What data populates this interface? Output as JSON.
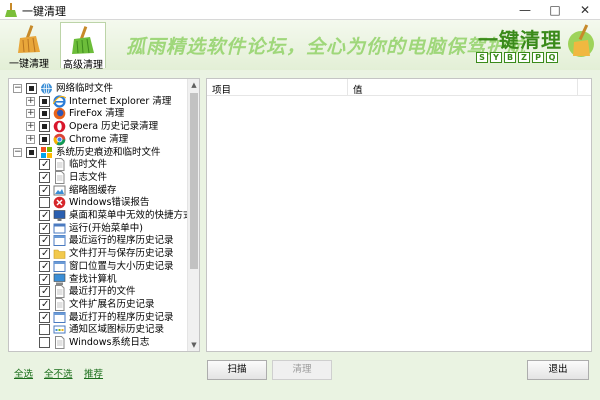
{
  "window": {
    "title": "一键清理",
    "controls": [
      "minimize",
      "maximize",
      "close"
    ]
  },
  "tabs": [
    {
      "label": "一键清理",
      "icon": "broom-icon",
      "active": false
    },
    {
      "label": "高级清理",
      "icon": "broom-icon",
      "active": true
    }
  ],
  "banner": {
    "slogan": "孤雨精选软件论坛，全心为你的电脑保驾护航",
    "logo_text": "一键清理",
    "logo_letters": [
      "S",
      "Y",
      "B",
      "Z",
      "P",
      "Q"
    ]
  },
  "tree": {
    "groups": [
      {
        "label": "网络临时文件",
        "icon": "globe-icon",
        "state": "partial",
        "children": [
          {
            "label": "Internet Explorer 清理",
            "icon": "ie-icon",
            "state": "partial"
          },
          {
            "label": "FireFox 清理",
            "icon": "firefox-icon",
            "state": "partial"
          },
          {
            "label": "Opera 历史记录清理",
            "icon": "opera-icon",
            "state": "partial"
          },
          {
            "label": "Chrome 清理",
            "icon": "chrome-icon",
            "state": "partial"
          }
        ]
      },
      {
        "label": "系统历史痕迹和临时文件",
        "icon": "windows-icon",
        "state": "partial",
        "children": [
          {
            "label": "临时文件",
            "icon": "file-icon",
            "state": "checked"
          },
          {
            "label": "日志文件",
            "icon": "file-icon",
            "state": "checked"
          },
          {
            "label": "缩略图缓存",
            "icon": "image-icon",
            "state": "checked"
          },
          {
            "label": "Windows错误报告",
            "icon": "error-icon",
            "state": "unchecked"
          },
          {
            "label": "桌面和菜单中无效的快捷方式",
            "icon": "desktop-icon",
            "state": "checked"
          },
          {
            "label": "运行(开始菜单中)",
            "icon": "run-icon",
            "state": "checked"
          },
          {
            "label": "最近运行的程序历史记录",
            "icon": "window-icon",
            "state": "checked"
          },
          {
            "label": "文件打开与保存历史记录",
            "icon": "folder-icon",
            "state": "checked"
          },
          {
            "label": "窗口位置与大小历史记录",
            "icon": "window-icon",
            "state": "checked"
          },
          {
            "label": "查找计算机",
            "icon": "computer-icon",
            "state": "checked"
          },
          {
            "label": "最近打开的文件",
            "icon": "file-icon",
            "state": "checked"
          },
          {
            "label": "文件扩展名历史记录",
            "icon": "file-icon",
            "state": "checked"
          },
          {
            "label": "最近打开的程序历史记录",
            "icon": "window-icon",
            "state": "checked"
          },
          {
            "label": "通知区域图标历史记录",
            "icon": "tray-icon",
            "state": "unchecked"
          },
          {
            "label": "Windows系统日志",
            "icon": "file-icon",
            "state": "unchecked"
          }
        ]
      }
    ]
  },
  "list": {
    "columns": [
      "项目",
      "值"
    ],
    "rows": []
  },
  "footer": {
    "select_all": "全选",
    "select_none": "全不选",
    "recommend": "推荐",
    "scan": "扫描",
    "clean": "清理",
    "exit": "退出"
  },
  "colors": {
    "accent_green": "#3a8a1a",
    "banner_text": "#9fd77a",
    "link": "#1a6e1a",
    "background": "#eaf3e2"
  }
}
